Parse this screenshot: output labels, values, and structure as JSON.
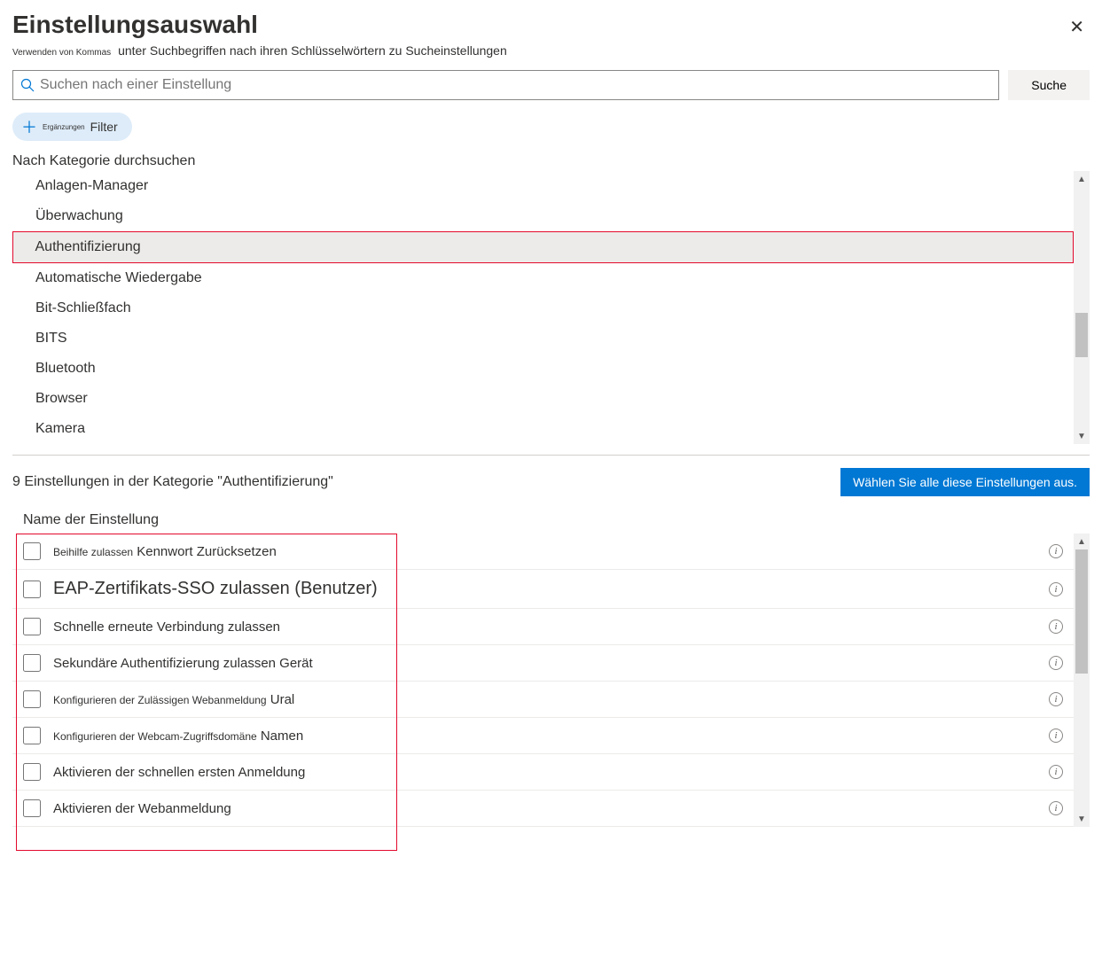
{
  "header": {
    "title": "Einstellungsauswahl",
    "subtitle_prefix": "Verwenden von Kommas",
    "subtitle_rest": "unter Suchbegriffen nach ihren Schlüsselwörtern zu Sucheinstellungen"
  },
  "search": {
    "placeholder": "Suchen nach einer Einstellung",
    "button": "Suche"
  },
  "filter": {
    "small": "Ergänzungen",
    "label": "Filter"
  },
  "browse_label": "Nach Kategorie durchsuchen",
  "categories": [
    {
      "label": "Anlagen-Manager",
      "selected": false
    },
    {
      "label": "Überwachung",
      "selected": false
    },
    {
      "label": "Authentifizierung",
      "selected": true
    },
    {
      "label": "Automatische Wiedergabe",
      "selected": false
    },
    {
      "label": "Bit-Schließfach",
      "selected": false
    },
    {
      "label": "BITS",
      "selected": false
    },
    {
      "label": "Bluetooth",
      "selected": false
    },
    {
      "label": "Browser",
      "selected": false
    },
    {
      "label": "Kamera",
      "selected": false
    }
  ],
  "results": {
    "count": "9",
    "text": "Einstellungen in der Kategorie \"Authentifizierung\"",
    "select_all": "Wählen Sie alle diese Einstellungen aus."
  },
  "col_header": "Name der Einstellung",
  "settings": [
    {
      "parts": [
        {
          "t": "Beihilfe zulassen",
          "c": "sm"
        },
        {
          "t": " Kennwort   Zurücksetzen",
          "c": ""
        }
      ],
      "featured": false
    },
    {
      "parts": [
        {
          "t": "EAP-Zertifikats-SSO zulassen (Benutzer)",
          "c": ""
        }
      ],
      "featured": true
    },
    {
      "parts": [
        {
          "t": "Schnelle erneute Verbindung zulassen",
          "c": ""
        }
      ],
      "featured": false
    },
    {
      "parts": [
        {
          "t": "Sekundäre Authentifizierung zulassen   Gerät",
          "c": ""
        }
      ],
      "featured": false
    },
    {
      "parts": [
        {
          "t": "Konfigurieren der Zulässigen Webanmeldung",
          "c": "sm"
        },
        {
          "t": "   Ural",
          "c": ""
        }
      ],
      "featured": false
    },
    {
      "parts": [
        {
          "t": "Konfigurieren der Webcam-Zugriffsdomäne",
          "c": "sm"
        },
        {
          "t": "   Namen",
          "c": ""
        }
      ],
      "featured": false
    },
    {
      "parts": [
        {
          "t": "Aktivieren der schnellen ersten Anmeldung",
          "c": ""
        }
      ],
      "featured": false
    },
    {
      "parts": [
        {
          "t": "Aktivieren der Webanmeldung",
          "c": ""
        }
      ],
      "featured": false
    }
  ]
}
